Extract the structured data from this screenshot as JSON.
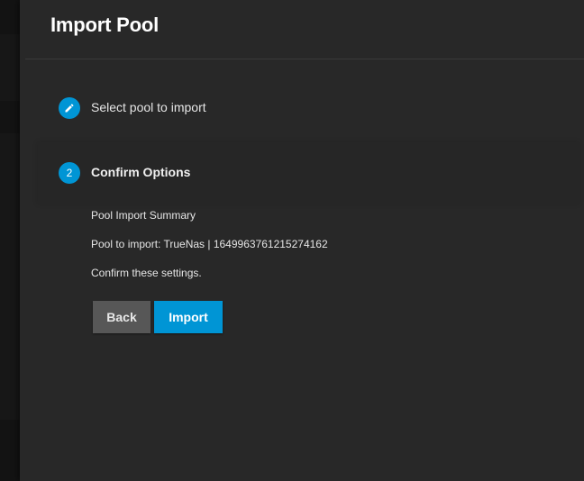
{
  "dialog": {
    "title": "Import Pool"
  },
  "steps": [
    {
      "number": "",
      "icon": "pencil-icon",
      "label": "Select pool to import",
      "state": "done"
    },
    {
      "number": "2",
      "icon": "",
      "label": "Confirm Options",
      "state": "active"
    }
  ],
  "summary": {
    "title": "Pool Import Summary",
    "pool_line": "Pool to import: TrueNas | 1649963761215274162",
    "confirm_text": "Confirm these settings."
  },
  "buttons": {
    "back_label": "Back",
    "import_label": "Import"
  },
  "colors": {
    "accent": "#0095d5",
    "dialog_bg": "#282828",
    "back_button": "#575757"
  }
}
